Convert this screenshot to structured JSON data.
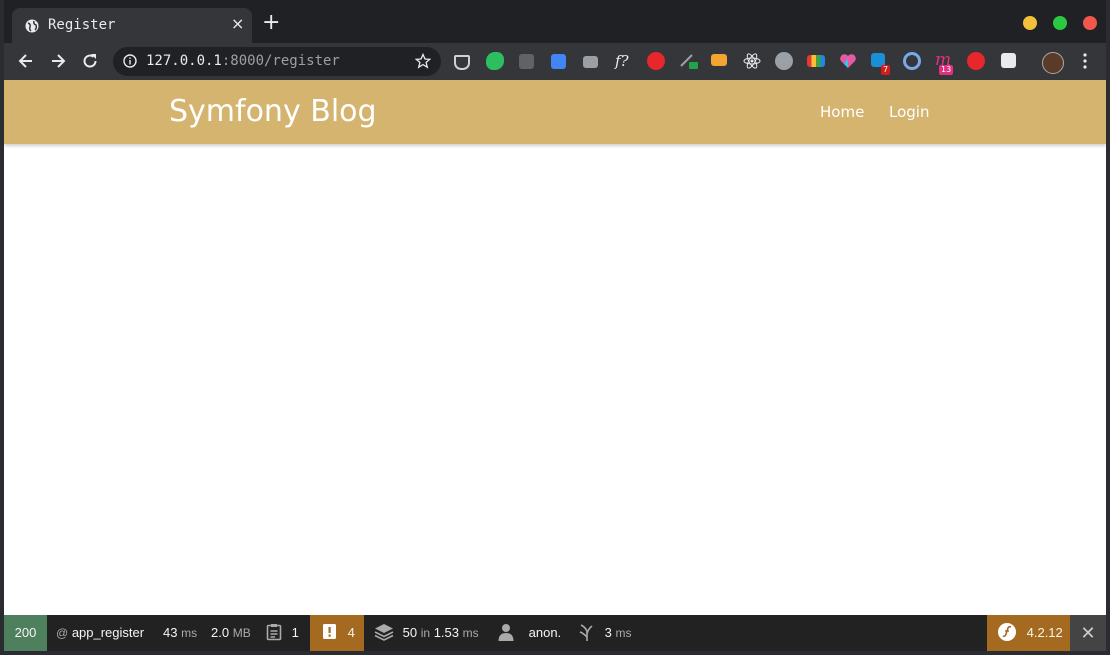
{
  "browser": {
    "tab_title": "Register",
    "tab_close": "×",
    "new_tab": "+",
    "url_host": "127.0.0.1",
    "url_rest": ":8000/register",
    "extension_badges": {
      "todo": "7",
      "monkey": "13"
    }
  },
  "site": {
    "brand": "Symfony Blog",
    "nav": {
      "home": "Home",
      "login": "Login"
    },
    "navbar_color": "#d4b46f"
  },
  "profiler": {
    "status_code": "200",
    "route_prefix": "@",
    "route": "app_register",
    "time_value": "43",
    "time_unit": "ms",
    "memory_value": "2.0",
    "memory_unit": "MB",
    "logs_count": "1",
    "warnings_count": "4",
    "cache_value": "50",
    "cache_in": "in",
    "cache_time": "1.53",
    "cache_unit": "ms",
    "user": "anon.",
    "twig_value": "3",
    "twig_unit": "ms",
    "version": "4.2.12",
    "close": "✕"
  },
  "colors": {
    "status_ok": "#4f805d",
    "warning": "#a46a1f"
  }
}
